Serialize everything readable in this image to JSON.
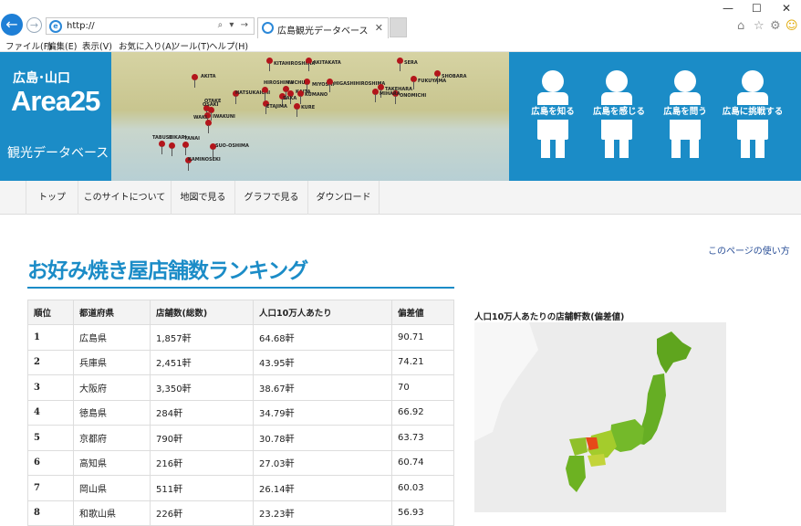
{
  "browser": {
    "address": "http://",
    "tab_title": "広島観光データベース",
    "back_glyph": "←",
    "forward_glyph": "→",
    "address_tools": "⌕ ▾ →",
    "tab_close": "✕",
    "win": {
      "min": "—",
      "max": "☐",
      "close": "✕"
    },
    "tools": {
      "home": "⌂",
      "star": "☆",
      "gear": "⚙",
      "smile": "☺"
    },
    "menu": [
      "ファイル(F)",
      "編集(E)",
      "表示(V)",
      "お気に入り(A)",
      "ツール(T)",
      "ヘルプ(H)"
    ]
  },
  "brand": {
    "region": "広島･山口",
    "name": "Area25",
    "subtitle": "観光データベース"
  },
  "map_pins": [
    {
      "label": "AKITA"
    },
    {
      "label": "KITAHIROSHIMA"
    },
    {
      "label": "AKITAKATA"
    },
    {
      "label": "SERA"
    },
    {
      "label": "MIYOSHI"
    },
    {
      "label": "SHOBARA"
    },
    {
      "label": "HIGASHIHIROSHIMA"
    },
    {
      "label": "TAKEHARA"
    },
    {
      "label": "FUKUYAMA"
    },
    {
      "label": "ONOMICHI"
    },
    {
      "label": "MIHARA"
    },
    {
      "label": "KURE"
    },
    {
      "label": "OTAKE"
    },
    {
      "label": "IWAKUNI"
    },
    {
      "label": "HATSUKAICHI"
    },
    {
      "label": "HIROSHIMA"
    },
    {
      "label": "FUCHU"
    },
    {
      "label": "KAITA"
    },
    {
      "label": "KUMANO"
    },
    {
      "label": "SAKA"
    },
    {
      "label": "ETAJIMA"
    },
    {
      "label": "YANAI"
    },
    {
      "label": "SUO-OSHIMA"
    },
    {
      "label": "KAMINOSEKI"
    },
    {
      "label": "TABUSE"
    },
    {
      "label": "HIKARI"
    },
    {
      "label": "WAKI"
    },
    {
      "label": "OSAKI"
    }
  ],
  "nav_figures": [
    {
      "label": "広島を知る"
    },
    {
      "label": "広島を感じる"
    },
    {
      "label": "広島を問う"
    },
    {
      "label": "広島に挑戦する"
    }
  ],
  "global_nav": [
    {
      "label": "トップ"
    },
    {
      "label": "このサイトについて"
    },
    {
      "label": "地図で見る"
    },
    {
      "label": "グラフで見る"
    },
    {
      "label": "ダウンロード"
    }
  ],
  "page": {
    "howto": "このページの使い方",
    "title": "お好み焼き屋店舗数ランキング",
    "map_caption": "人口10万人あたりの店舗軒数(偏差値)"
  },
  "table": {
    "headers": [
      "順位",
      "都道府県",
      "店舗数(総数)",
      "人口10万人あたり",
      "偏差値"
    ],
    "rows": [
      [
        "1",
        "広島県",
        "1,857軒",
        "64.68軒",
        "90.71"
      ],
      [
        "2",
        "兵庫県",
        "2,451軒",
        "43.95軒",
        "74.21"
      ],
      [
        "3",
        "大阪府",
        "3,350軒",
        "38.67軒",
        "70"
      ],
      [
        "4",
        "徳島県",
        "284軒",
        "34.79軒",
        "66.92"
      ],
      [
        "5",
        "京都府",
        "790軒",
        "30.78軒",
        "63.73"
      ],
      [
        "6",
        "高知県",
        "216軒",
        "27.03軒",
        "60.74"
      ],
      [
        "7",
        "岡山県",
        "511軒",
        "26.14軒",
        "60.03"
      ],
      [
        "8",
        "和歌山県",
        "226軒",
        "23.23軒",
        "56.93"
      ]
    ]
  },
  "colors": {
    "accent": "#1b8cc7",
    "pin": "#b3151b"
  }
}
